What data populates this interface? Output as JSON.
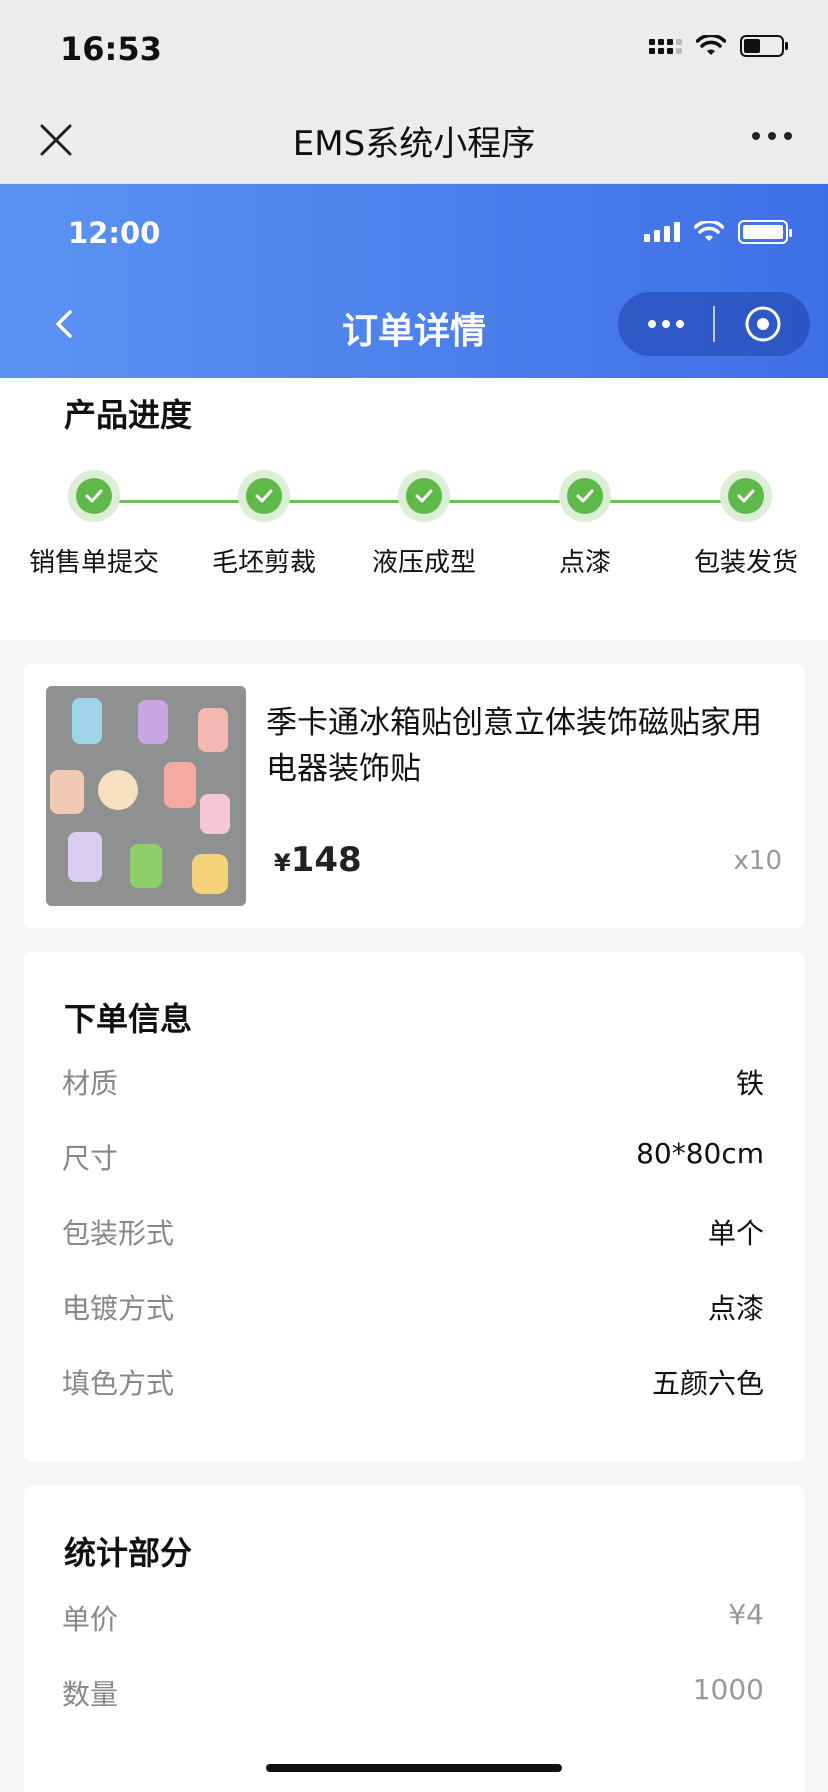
{
  "system_status": {
    "time": "16:53"
  },
  "host_bar": {
    "title": "EMS系统小程序"
  },
  "app_header": {
    "time": "12:00",
    "title": "订单详情"
  },
  "progress": {
    "title": "产品进度",
    "steps": [
      {
        "label": "销售单提交",
        "done": true
      },
      {
        "label": "毛坯剪裁",
        "done": true
      },
      {
        "label": "液压成型",
        "done": true
      },
      {
        "label": "点漆",
        "done": true
      },
      {
        "label": "包装发货",
        "done": true
      }
    ]
  },
  "product": {
    "name": "季卡通冰箱贴创意立体装饰磁贴家用电器装饰贴",
    "currency": "¥",
    "price": "148",
    "quantity": "x10"
  },
  "order_info": {
    "title": "下单信息",
    "rows": [
      {
        "key": "材质",
        "value": "铁"
      },
      {
        "key": "尺寸",
        "value": "80*80cm"
      },
      {
        "key": "包装形式",
        "value": "单个"
      },
      {
        "key": "电镀方式",
        "value": "点漆"
      },
      {
        "key": "填色方式",
        "value": "五颜六色"
      }
    ]
  },
  "stats": {
    "title": "统计部分",
    "rows": [
      {
        "key": "单价",
        "value": "¥4"
      },
      {
        "key": "数量",
        "value": "1000"
      }
    ]
  },
  "colors": {
    "header_gradient_start": "#5b93f2",
    "header_gradient_end": "#3f6fe6",
    "step_done": "#5fb84a"
  }
}
